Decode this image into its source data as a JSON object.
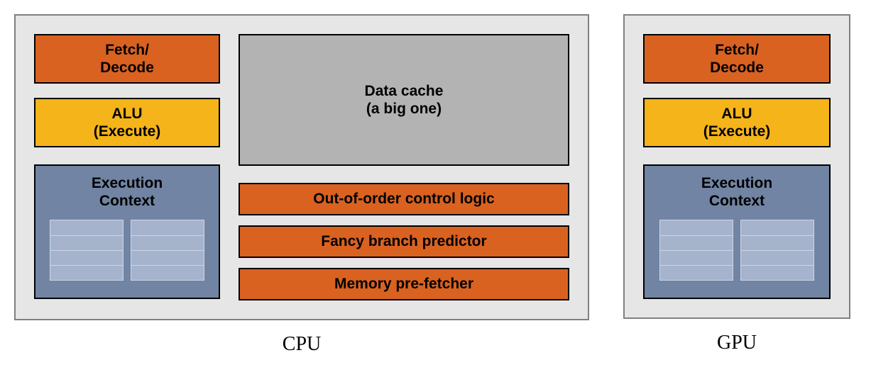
{
  "cpu": {
    "caption": "CPU",
    "fetch": "Fetch/\nDecode",
    "alu": "ALU\n(Execute)",
    "exec": "Execution\nContext",
    "cache": "Data cache\n(a big one)",
    "ooo": "Out-of-order control logic",
    "branch": "Fancy branch predictor",
    "prefetch": "Memory pre-fetcher"
  },
  "gpu": {
    "caption": "GPU",
    "fetch": "Fetch/\nDecode",
    "alu": "ALU\n(Execute)",
    "exec": "Execution\nContext"
  },
  "colors": {
    "orange": "#d96221",
    "yellow": "#f4b41a",
    "gray": "#b3b3b3",
    "blue": "#7184a3",
    "panel_bg": "#e6e6e6",
    "panel_border": "#808080"
  }
}
